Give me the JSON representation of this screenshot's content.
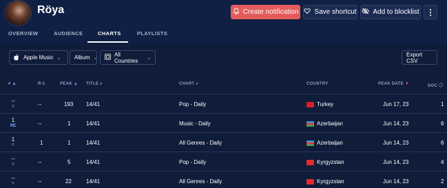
{
  "artist": {
    "name": "Röya"
  },
  "header": {
    "create_notification": "Create notification",
    "save_shortcut": "Save shortcut",
    "add_to_blocklist": "Add to blocklist",
    "more": "⋮"
  },
  "tabs": [
    {
      "label": "OVERVIEW"
    },
    {
      "label": "AUDIENCE"
    },
    {
      "label": "CHARTS",
      "active": true
    },
    {
      "label": "PLAYLISTS"
    }
  ],
  "filters": {
    "platform": "Apple Music",
    "type": "Album",
    "country": "All Countries",
    "export": "Export CSV"
  },
  "table": {
    "headers": [
      "#",
      "R-1",
      "PEAK",
      "TITLE",
      "CHART",
      "COUNTRY",
      "PEAK DATE",
      "DOC"
    ],
    "rows": [
      {
        "rank": "--",
        "sub": "=",
        "r1": "--",
        "peak": "193",
        "title": "14/41",
        "chart": "Pop - Daily",
        "country": "Turkey",
        "flag": "tr",
        "peak_date": "Jun 17, 23",
        "doc": "1"
      },
      {
        "rank": "1",
        "sub": "RE",
        "r1": "--",
        "peak": "1",
        "title": "14/41",
        "chart": "Music - Daily",
        "country": "Azerbaijan",
        "flag": "az",
        "peak_date": "Jun 14, 23",
        "doc": "6"
      },
      {
        "rank": "1",
        "sub": "=",
        "r1": "1",
        "peak": "1",
        "title": "14/41",
        "chart": "All Genres - Daily",
        "country": "Azerbaijan",
        "flag": "az",
        "peak_date": "Jun 14, 23",
        "doc": "6"
      },
      {
        "rank": "--",
        "sub": "=",
        "r1": "--",
        "peak": "5",
        "title": "14/41",
        "chart": "Pop - Daily",
        "country": "Kyrgyzstan",
        "flag": "kg",
        "peak_date": "Jun 14, 23",
        "doc": "4"
      },
      {
        "rank": "--",
        "sub": "=",
        "r1": "--",
        "peak": "22",
        "title": "14/41",
        "chart": "All Genres - Daily",
        "country": "Kyrgyzstan",
        "flag": "kg",
        "peak_date": "Jun 14, 23",
        "doc": "2"
      }
    ]
  },
  "colors": {
    "background": "#0f1c3a",
    "accent_red": "#e45b5b",
    "link_blue": "#7fa6ff"
  }
}
